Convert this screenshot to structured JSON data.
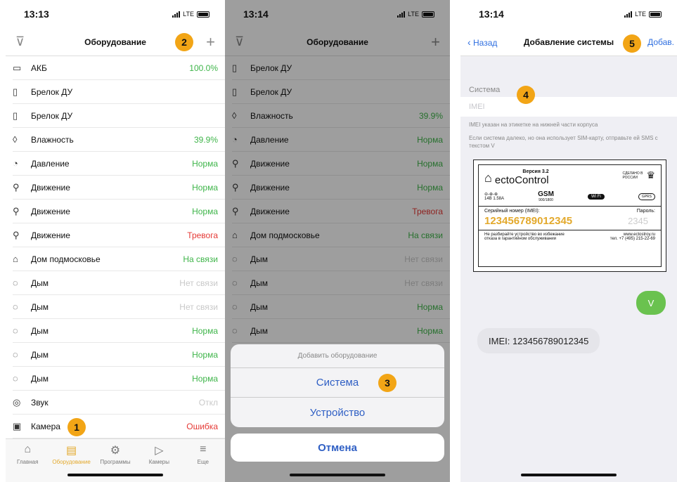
{
  "screen1": {
    "time": "13:13",
    "network": "LTE",
    "title": "Оборудование",
    "items": [
      {
        "icon": "calendar-icon",
        "glyph": "▭",
        "name": "АКБ",
        "value": "100.0%",
        "status": "ok"
      },
      {
        "icon": "keyfob-icon",
        "glyph": "▯",
        "name": "Брелок ДУ",
        "value": "",
        "status": "none"
      },
      {
        "icon": "keyfob-icon",
        "glyph": "▯",
        "name": "Брелок ДУ",
        "value": "",
        "status": "none"
      },
      {
        "icon": "humidity-icon",
        "glyph": "◊",
        "name": "Влажность",
        "value": "39.9%",
        "status": "ok"
      },
      {
        "icon": "gauge-icon",
        "glyph": "◔",
        "name": "Давление",
        "value": "Норма",
        "status": "ok"
      },
      {
        "icon": "motion-icon",
        "glyph": "⚲",
        "name": "Движение",
        "value": "Норма",
        "status": "ok"
      },
      {
        "icon": "motion-icon",
        "glyph": "⚲",
        "name": "Движение",
        "value": "Норма",
        "status": "ok"
      },
      {
        "icon": "motion-icon",
        "glyph": "⚲",
        "name": "Движение",
        "value": "Тревога",
        "status": "bad"
      },
      {
        "icon": "house-device-icon",
        "glyph": "⌂",
        "name": "Дом подмосковье",
        "value": "На связи",
        "status": "ok"
      },
      {
        "icon": "smoke-icon",
        "glyph": "◌",
        "name": "Дым",
        "value": "Нет связи",
        "status": "na"
      },
      {
        "icon": "smoke-icon",
        "glyph": "◌",
        "name": "Дым",
        "value": "Нет связи",
        "status": "na"
      },
      {
        "icon": "smoke-icon",
        "glyph": "◌",
        "name": "Дым",
        "value": "Норма",
        "status": "ok"
      },
      {
        "icon": "smoke-icon",
        "glyph": "◌",
        "name": "Дым",
        "value": "Норма",
        "status": "ok"
      },
      {
        "icon": "smoke-icon",
        "glyph": "◌",
        "name": "Дым",
        "value": "Норма",
        "status": "ok"
      },
      {
        "icon": "sound-icon",
        "glyph": "◎",
        "name": "Звук",
        "value": "Откл",
        "status": "na"
      },
      {
        "icon": "camera-icon",
        "glyph": "▣",
        "name": "Камера",
        "value": "Ошибка",
        "status": "bad"
      }
    ],
    "tabs": [
      {
        "icon": "home-icon",
        "glyph": "⌂",
        "label": "Главная"
      },
      {
        "icon": "equipment-icon",
        "glyph": "▤",
        "label": "Оборудование",
        "active": true
      },
      {
        "icon": "programs-icon",
        "glyph": "⚙",
        "label": "Программы"
      },
      {
        "icon": "cameras-icon",
        "glyph": "▷",
        "label": "Камеры"
      },
      {
        "icon": "more-icon",
        "glyph": "≡",
        "label": "Еще"
      }
    ],
    "badges": [
      "1",
      "2"
    ]
  },
  "screen2": {
    "time": "13:14",
    "network": "LTE",
    "title": "Оборудование",
    "items": [
      {
        "icon": "keyfob-icon",
        "glyph": "▯",
        "name": "Брелок ДУ",
        "value": "",
        "status": "none"
      },
      {
        "icon": "keyfob-icon",
        "glyph": "▯",
        "name": "Брелок ДУ",
        "value": "",
        "status": "none"
      },
      {
        "icon": "humidity-icon",
        "glyph": "◊",
        "name": "Влажность",
        "value": "39.9%",
        "status": "ok"
      },
      {
        "icon": "gauge-icon",
        "glyph": "◔",
        "name": "Давление",
        "value": "Норма",
        "status": "ok"
      },
      {
        "icon": "motion-icon",
        "glyph": "⚲",
        "name": "Движение",
        "value": "Норма",
        "status": "ok"
      },
      {
        "icon": "motion-icon",
        "glyph": "⚲",
        "name": "Движение",
        "value": "Норма",
        "status": "ok"
      },
      {
        "icon": "motion-icon",
        "glyph": "⚲",
        "name": "Движение",
        "value": "Тревога",
        "status": "bad"
      },
      {
        "icon": "house-device-icon",
        "glyph": "⌂",
        "name": "Дом подмосковье",
        "value": "На связи",
        "status": "ok"
      },
      {
        "icon": "smoke-icon",
        "glyph": "◌",
        "name": "Дым",
        "value": "Нет связи",
        "status": "na"
      },
      {
        "icon": "smoke-icon",
        "glyph": "◌",
        "name": "Дым",
        "value": "Нет связи",
        "status": "na"
      },
      {
        "icon": "smoke-icon",
        "glyph": "◌",
        "name": "Дым",
        "value": "Норма",
        "status": "ok"
      },
      {
        "icon": "smoke-icon",
        "glyph": "◌",
        "name": "Дым",
        "value": "Норма",
        "status": "ok"
      }
    ],
    "sheet": {
      "header": "Добавить оборудование",
      "option_system": "Система",
      "option_device": "Устройство",
      "cancel": "Отмена"
    },
    "badges": [
      "3"
    ]
  },
  "screen3": {
    "time": "13:14",
    "network": "LTE",
    "back": "Назад",
    "title": "Добавление системы",
    "add": "Добав.",
    "section": "Система",
    "imei_placeholder": "IMEI",
    "hint1": "IMEI указан на этикетке на нижней части корпуса",
    "hint2": "Если система далеко, но она использует SIM-карту, отправьте ей SMS с текстом V",
    "label": {
      "version": "Версия 3.2",
      "brand": "ectoControl",
      "made_in": "СДЕЛАНО В РОССИИ",
      "power": "14В 1.58А",
      "gsm": "GSM",
      "gsm_bands": "900/1800",
      "wifi": "Wi Fi",
      "gprs": "GPRS",
      "serial_label": "Серийный номер (IMEI):",
      "password_label": "Пароль:",
      "serial": "123456789012345",
      "password": "2345",
      "warning": "Не разбирайте устройство во избежание отказа в гарантийном обслуживании",
      "site": "www.ectostroy.ru",
      "phone": "тел. +7 (495) 215-22-69"
    },
    "sms_out": "V",
    "sms_in": "IMEI: 123456789012345",
    "badges": [
      "4",
      "5"
    ]
  },
  "colors": {
    "ok": "#3fb54a",
    "bad": "#e53935",
    "na": "#c9c9c9",
    "accent": "#f2a516",
    "link": "#2f6fe0",
    "sms_out": "#6ac24f",
    "sms_in": "#e5e5ea"
  }
}
